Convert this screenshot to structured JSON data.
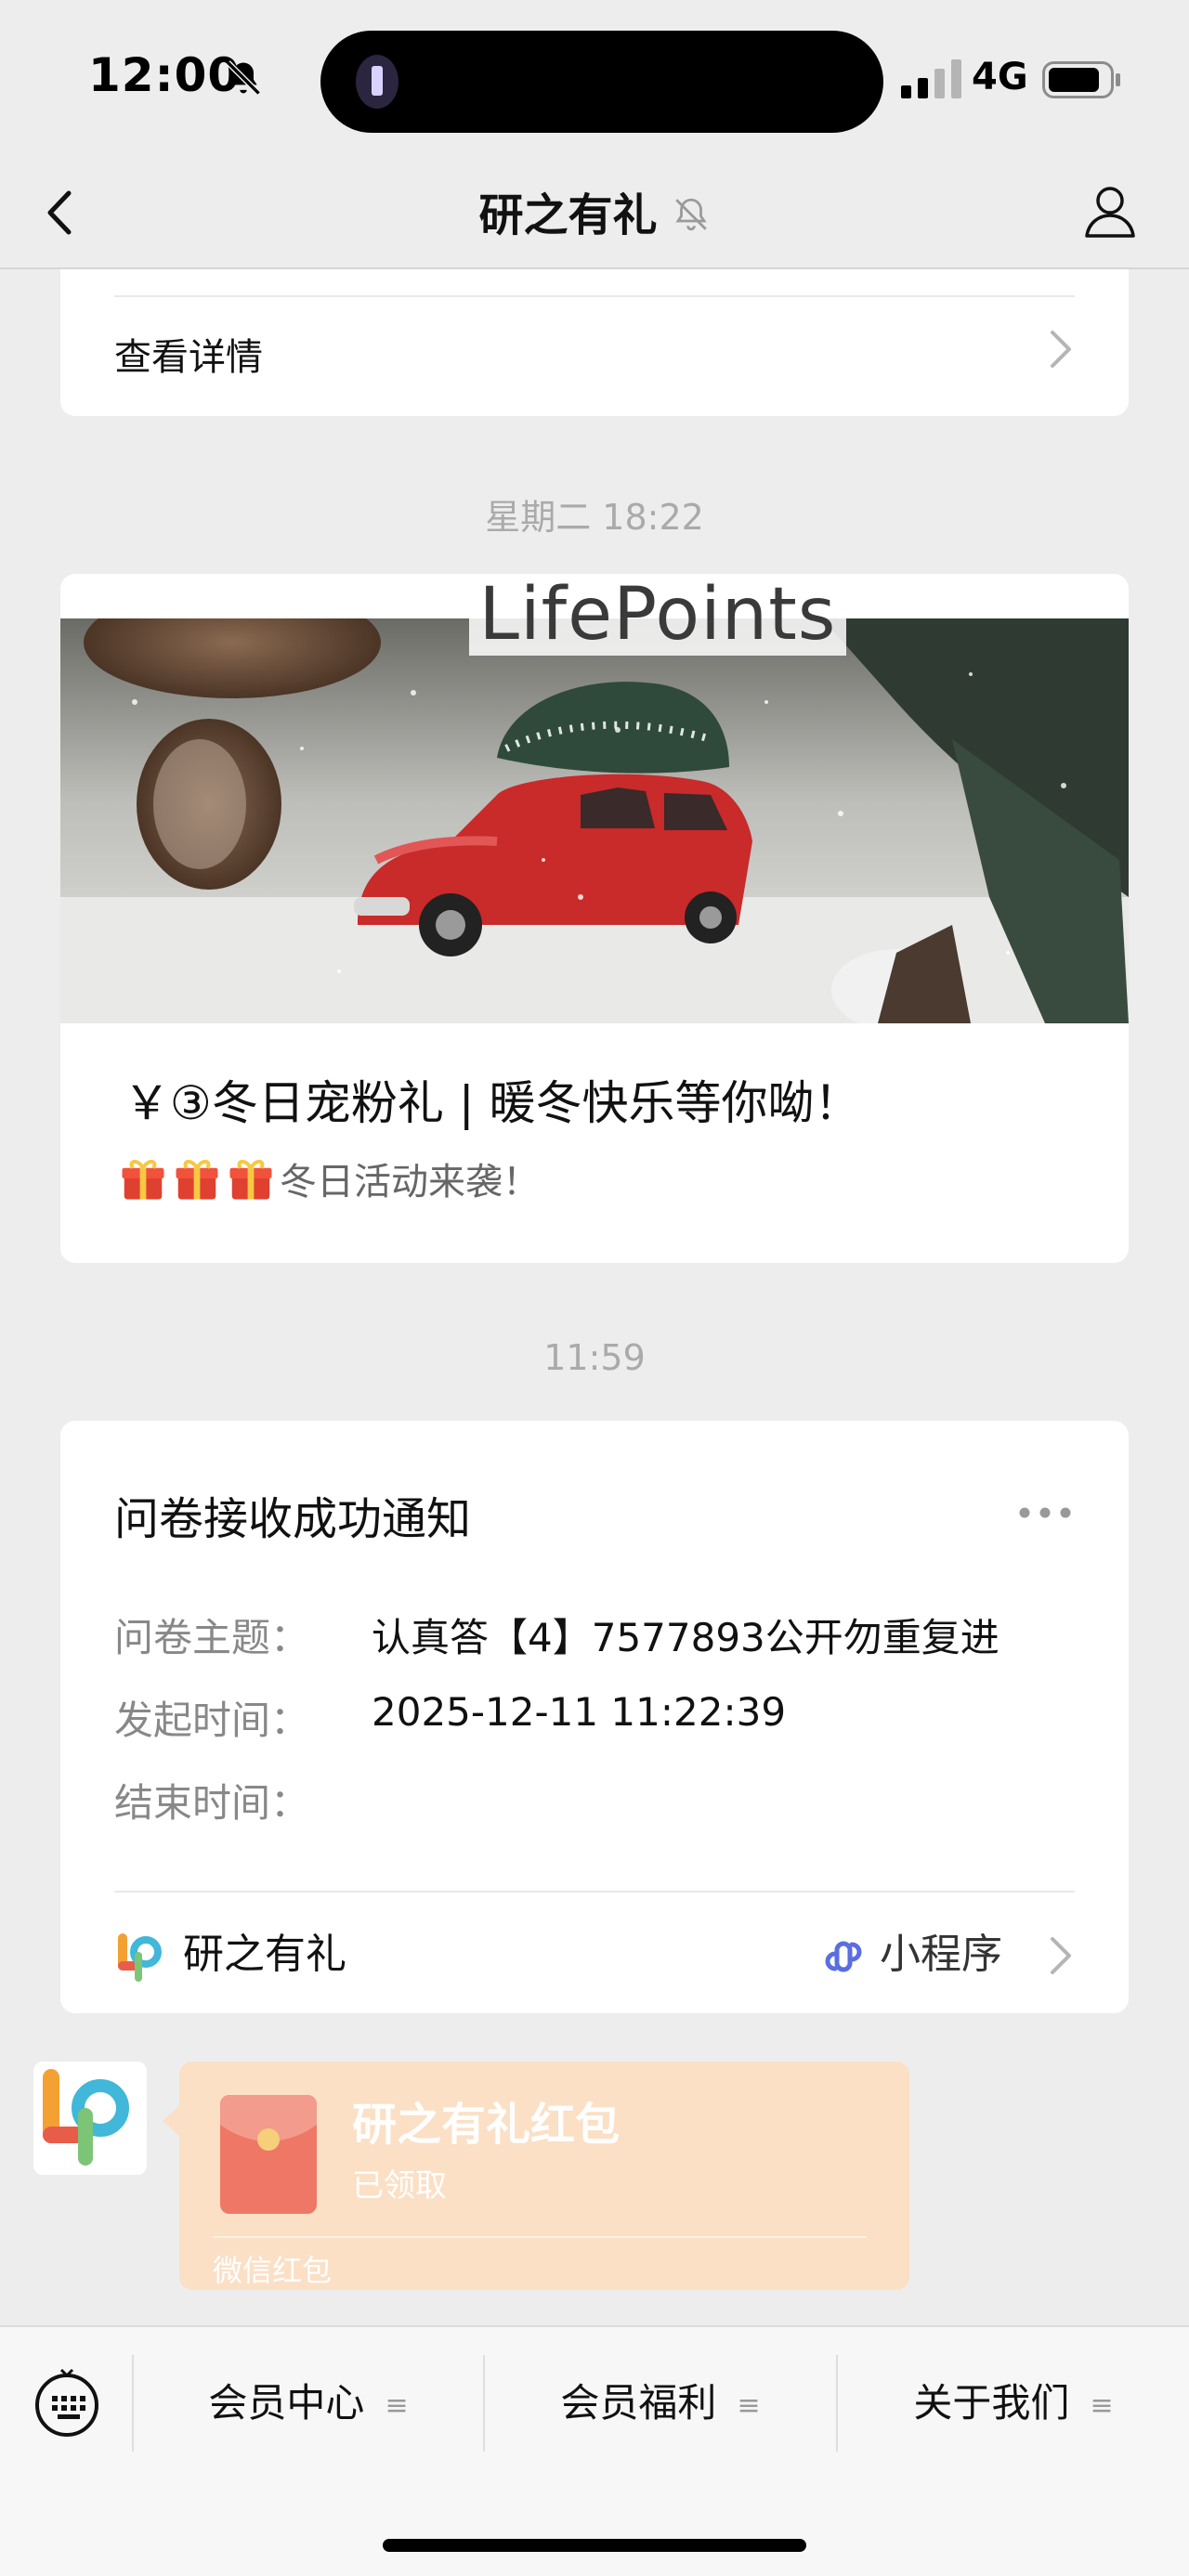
{
  "status_bar": {
    "time": "12:00",
    "network": "4G",
    "icons": [
      "bell-slash-icon",
      "flashlight-icon",
      "signal-icon",
      "battery-icon"
    ]
  },
  "nav": {
    "title": "研之有礼",
    "icons": [
      "back-chevron-icon",
      "mute-bell-icon",
      "profile-icon"
    ]
  },
  "top_card": {
    "detail_label": "查看详情"
  },
  "timestamps": {
    "first": "星期二 18:22",
    "second": "11:59"
  },
  "article": {
    "logo_text": "LifePoints",
    "title": "￥③冬日宠粉礼 | 暖冬快乐等你呦！",
    "subtitle": "冬日活动来袭！",
    "gift_icon": "gift-icon"
  },
  "notice": {
    "title": "问卷接收成功通知",
    "rows": [
      {
        "key": "问卷主题：",
        "value": "认真答【4】7577893公开勿重复进"
      },
      {
        "key": "发起时间：",
        "value": "2025-12-11 11:22:39"
      },
      {
        "key": "结束时间：",
        "value": ""
      }
    ],
    "app_name": "研之有礼",
    "mini_program_label": "小程序"
  },
  "red_packet": {
    "title": "研之有礼红包",
    "status": "已领取",
    "footer": "微信红包"
  },
  "bottom_menu": {
    "items": [
      {
        "label": "会员中心",
        "glyph": "≡"
      },
      {
        "label": "会员福利",
        "glyph": "≡"
      },
      {
        "label": "关于我们",
        "glyph": "≡"
      }
    ]
  },
  "colors": {
    "background": "#ededed",
    "card": "#ffffff",
    "red_packet": "#fbe0c6",
    "packet_red": "#ef7766",
    "mini_program_blue": "#5a6ee0"
  }
}
